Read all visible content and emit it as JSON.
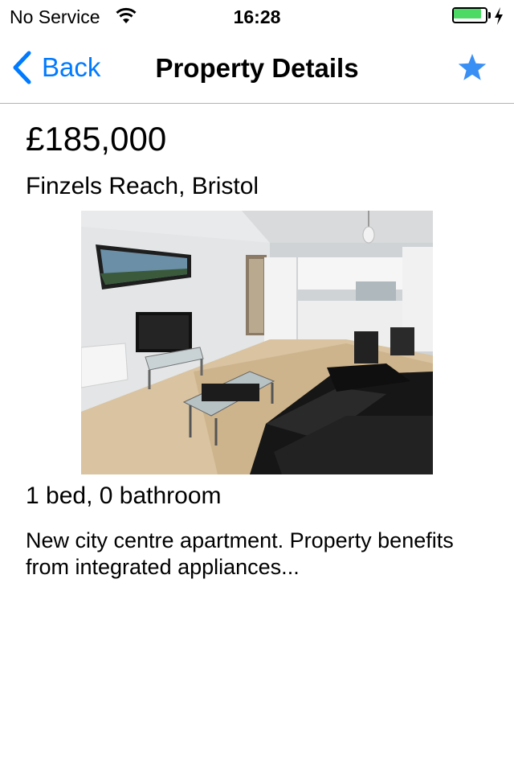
{
  "status_bar": {
    "carrier": "No Service",
    "time": "16:28",
    "battery_level": 0.95,
    "wifi_icon": "wifi-icon",
    "charging_icon": "bolt-icon"
  },
  "nav": {
    "back_label": "Back",
    "title": "Property Details",
    "favourite_icon": "star-icon"
  },
  "property": {
    "price": "£185,000",
    "location": "Finzels Reach, Bristol",
    "rooms": "1 bed, 0 bathroom",
    "description": "New city centre apartment. Property benefits from integrated appliances..."
  },
  "colors": {
    "accent": "#007aff",
    "battery": "#4cd964",
    "favourite": "#3a8ff5"
  }
}
